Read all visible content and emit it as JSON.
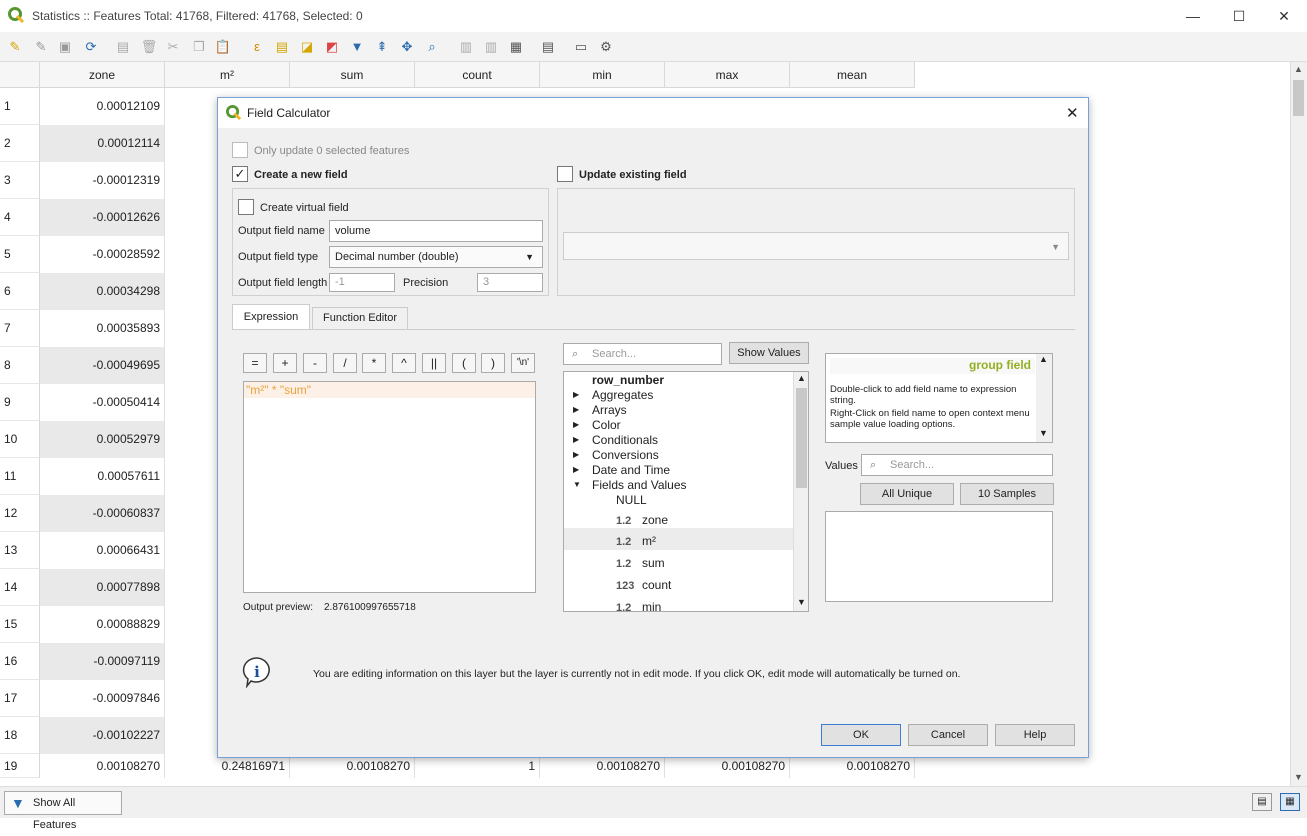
{
  "window": {
    "title": "Statistics :: Features Total: 41768, Filtered: 41768, Selected: 0",
    "minimize": "—",
    "maximize": "☐",
    "close": "✕"
  },
  "table": {
    "columns": [
      "zone",
      "m²",
      "sum",
      "count",
      "min",
      "max",
      "mean"
    ],
    "rows": [
      {
        "n": "1",
        "zone": "0.00012109"
      },
      {
        "n": "2",
        "zone": "0.00012114"
      },
      {
        "n": "3",
        "zone": "-0.00012319"
      },
      {
        "n": "4",
        "zone": "-0.00012626"
      },
      {
        "n": "5",
        "zone": "-0.00028592"
      },
      {
        "n": "6",
        "zone": "0.00034298"
      },
      {
        "n": "7",
        "zone": "0.00035893"
      },
      {
        "n": "8",
        "zone": "-0.00049695"
      },
      {
        "n": "9",
        "zone": "-0.00050414"
      },
      {
        "n": "10",
        "zone": "0.00052979"
      },
      {
        "n": "11",
        "zone": "0.00057611"
      },
      {
        "n": "12",
        "zone": "-0.00060837"
      },
      {
        "n": "13",
        "zone": "0.00066431"
      },
      {
        "n": "14",
        "zone": "0.00077898"
      },
      {
        "n": "15",
        "zone": "0.00088829"
      },
      {
        "n": "16",
        "zone": "-0.00097119"
      },
      {
        "n": "17",
        "zone": "-0.00097846"
      },
      {
        "n": "18",
        "zone": "-0.00102227"
      },
      {
        "n": "19",
        "zone": "0.00108270",
        "m2": "0.24816971",
        "sum": "0.00108270",
        "count": "1",
        "min": "0.00108270",
        "max": "0.00108270",
        "mean": "0.00108270"
      }
    ],
    "show_all": "Show All Features"
  },
  "dialog": {
    "title": "Field Calculator",
    "only_update": "Only update 0 selected features",
    "create_new": "Create a new field",
    "update_existing": "Update existing field",
    "create_virtual": "Create virtual field",
    "output_name_label": "Output field name",
    "output_name": "volume",
    "output_type_label": "Output field type",
    "output_type": "Decimal number (double)",
    "output_length_label": "Output field length",
    "output_length": "-1",
    "precision_label": "Precision",
    "precision": "3",
    "tab_expression": "Expression",
    "tab_function_editor": "Function Editor",
    "operators": [
      "=",
      "+",
      "-",
      "/",
      "*",
      "^",
      "||",
      "(",
      ")",
      "'\\n'"
    ],
    "expression": "\"m²\" * \"sum\"",
    "preview_label": "Output preview:",
    "preview_value": "2.876100997655718",
    "search_placeholder": "Search...",
    "show_values": "Show Values",
    "tree": {
      "top": "row_number",
      "groups": [
        "Aggregates",
        "Arrays",
        "Color",
        "Conditionals",
        "Conversions",
        "Date and Time",
        "Fields and Values"
      ],
      "fields": [
        {
          "type": "",
          "name": "NULL"
        },
        {
          "type": "1.2",
          "name": "zone"
        },
        {
          "type": "1.2",
          "name": "m²"
        },
        {
          "type": "1.2",
          "name": "sum"
        },
        {
          "type": "123",
          "name": "count"
        },
        {
          "type": "1.2",
          "name": "min"
        }
      ]
    },
    "help_title": "group field",
    "help_text1": "Double-click to add field name to expression string.",
    "help_text2": "Right-Click on field name to open context menu sample value loading options.",
    "values_label": "Values",
    "values_search": "Search...",
    "all_unique": "All Unique",
    "samples": "10 Samples",
    "info_msg": "You are editing information on this layer but the layer is currently not in edit mode. If you click OK, edit mode will automatically be turned on.",
    "ok": "OK",
    "cancel": "Cancel",
    "help": "Help"
  }
}
